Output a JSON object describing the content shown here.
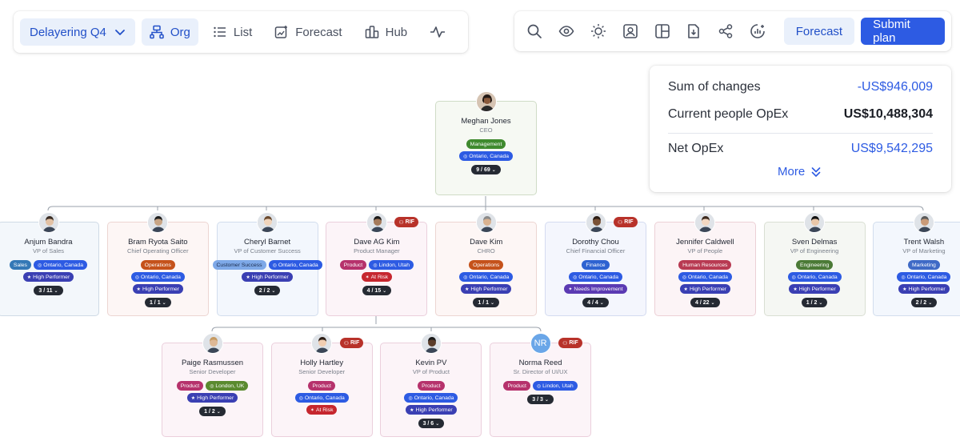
{
  "toolbar": {
    "scenario": "Delayering Q4",
    "tabs": [
      {
        "label": "Org",
        "icon": "org-chart-icon",
        "active": true
      },
      {
        "label": "List",
        "icon": "list-icon",
        "active": false
      },
      {
        "label": "Forecast",
        "icon": "forecast-icon",
        "active": false
      },
      {
        "label": "Hub",
        "icon": "hub-icon",
        "active": false
      },
      {
        "label": "",
        "icon": "activity-icon",
        "active": false
      }
    ],
    "tools": [
      "search-icon",
      "eye-icon",
      "brightness-icon",
      "contact-card-icon",
      "layout-icon",
      "download-file-icon",
      "share-icon",
      "analytics-icon"
    ],
    "forecast_label": "Forecast",
    "submit_label": "Submit plan"
  },
  "summary": {
    "sum_changes_label": "Sum of changes",
    "sum_changes_value": "-US$946,009",
    "current_opex_label": "Current people OpEx",
    "current_opex_value": "US$10,488,304",
    "net_opex_label": "Net OpEx",
    "net_opex_value": "US$9,542,295",
    "more_label": "More"
  },
  "colors": {
    "accent": "#2d5be3",
    "accent_light": "#e9f0fb",
    "rif": "#b8322a"
  },
  "rif_label": "RIF",
  "ceo": {
    "name": "Meghan Jones",
    "title": "CEO",
    "dept": "Management",
    "location": "Ontario, Canada",
    "count": "9 / 69"
  },
  "reports": [
    {
      "name": "Anjum Bandra",
      "title": "VP of Sales",
      "dept": "Sales",
      "location": "Ontario, Canada",
      "status": "High Performer",
      "count": "3 / 11",
      "rif": false
    },
    {
      "name": "Bram Ryota Saito",
      "title": "Chief Operating Officer",
      "dept": "Operations",
      "location": "Ontario, Canada",
      "status": "High Performer",
      "count": "1 / 1",
      "rif": false
    },
    {
      "name": "Cheryl Barnet",
      "title": "VP of Customer Success",
      "dept": "Customer Success",
      "location": "Ontario, Canada",
      "status": "High Performer",
      "count": "2 / 2",
      "rif": false
    },
    {
      "name": "Dave AG Kim",
      "title": "Product Manager",
      "dept": "Product",
      "location": "Lindon, Utah",
      "status": "At Risk",
      "count": "4 / 15",
      "rif": true
    },
    {
      "name": "Dave Kim",
      "title": "CHRO",
      "dept": "Operations",
      "location": "Ontario, Canada",
      "status": "High Performer",
      "count": "1 / 1",
      "rif": false
    },
    {
      "name": "Dorothy Chou",
      "title": "Chief Financial Officer",
      "dept": "Finance",
      "location": "Ontario, Canada",
      "status": "Needs Improvement",
      "count": "4 / 4",
      "rif": true
    },
    {
      "name": "Jennifer Caldwell",
      "title": "VP of People",
      "dept": "Human Resources",
      "location": "Ontario, Canada",
      "status": "High Performer",
      "count": "4 / 22",
      "rif": false
    },
    {
      "name": "Sven Delmas",
      "title": "VP of Engineering",
      "dept": "Engineering",
      "location": "Ontario, Canada",
      "status": "High Performer",
      "count": "1 / 2",
      "rif": false
    },
    {
      "name": "Trent Walsh",
      "title": "VP of Marketing",
      "dept": "Marketing",
      "location": "Ontario, Canada",
      "status": "High Performer",
      "count": "2 / 2",
      "rif": false
    }
  ],
  "subreports": [
    {
      "name": "Paige Rasmussen",
      "title": "Senior Developer",
      "dept": "Product",
      "location": "London, UK",
      "status": "High Performer",
      "count": "1 / 2",
      "rif": false
    },
    {
      "name": "Holly Hartley",
      "title": "Senior Developer",
      "dept": "Product",
      "location": "Ontario, Canada",
      "status": "At Risk",
      "count": "",
      "rif": true
    },
    {
      "name": "Kevin PV",
      "title": "VP of Product",
      "dept": "Product",
      "location": "Ontario, Canada",
      "status": "High Performer",
      "count": "3 / 6",
      "rif": false
    },
    {
      "name": "Norma Reed",
      "title": "Sr. Director of UI/UX",
      "dept": "Product",
      "location": "Lindon, Utah",
      "status": "",
      "count": "3 / 3",
      "rif": true,
      "initials": "NR"
    }
  ]
}
